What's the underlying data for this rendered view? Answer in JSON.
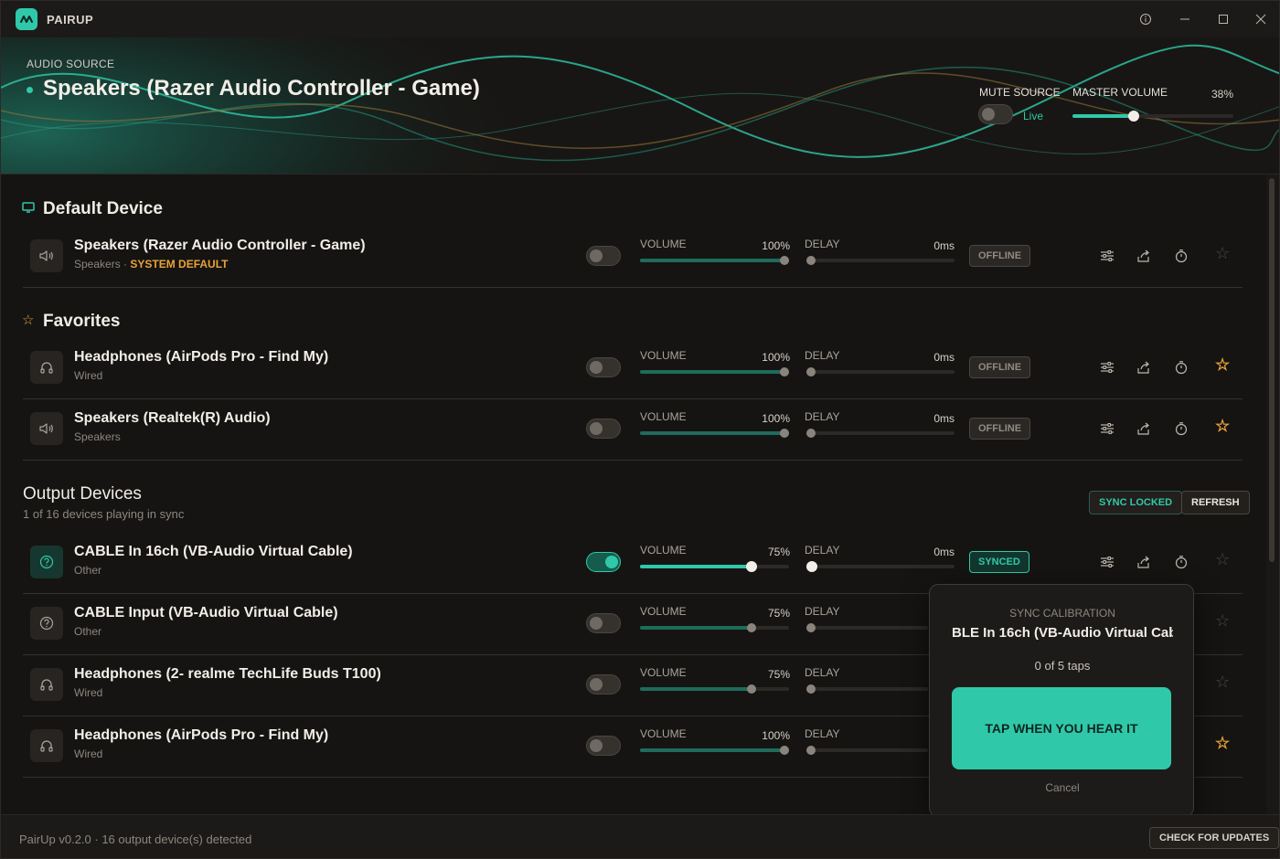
{
  "app": {
    "name": "PAIRUP"
  },
  "window": {
    "info_icon": "info-icon",
    "minimize_icon": "minimize-icon",
    "maximize_icon": "maximize-icon",
    "close_icon": "close-icon"
  },
  "hero": {
    "label": "AUDIO SOURCE",
    "source_name": "Speakers (Razer Audio Controller - Game)",
    "mute_label": "MUTE SOURCE",
    "mute_state": "Live",
    "master_label": "MASTER VOLUME",
    "master_value": "38%",
    "master_level": 0.38
  },
  "sections": {
    "default_title": "Default Device",
    "favorites_title": "Favorites",
    "outputs_title": "Output Devices",
    "outputs_subtitle": "1 of 16 devices playing in sync",
    "sync_locked": "SYNC LOCKED",
    "refresh": "REFRESH"
  },
  "labels": {
    "volume": "VOLUME",
    "delay": "DELAY"
  },
  "rows": [
    {
      "name": "Speakers (Razer Audio Controller - Game)",
      "type": "Speakers",
      "badge": " · ",
      "badge_def": "SYSTEM DEFAULT",
      "icon": "speaker-icon",
      "on": false,
      "volume": "100%",
      "vol_level": 1.0,
      "delay": "0ms",
      "status": "OFFLINE",
      "fav": false
    },
    {
      "name": "Headphones (AirPods Pro - Find My)",
      "type": "Wired",
      "icon": "headphones-icon",
      "on": false,
      "volume": "100%",
      "vol_level": 1.0,
      "delay": "0ms",
      "status": "OFFLINE",
      "fav": true
    },
    {
      "name": "Speakers (Realtek(R) Audio)",
      "type": "Speakers",
      "icon": "speaker-icon",
      "on": false,
      "volume": "100%",
      "vol_level": 1.0,
      "delay": "0ms",
      "status": "OFFLINE",
      "fav": true
    },
    {
      "name": "CABLE In 16ch (VB-Audio Virtual Cable)",
      "type": "Other",
      "icon": "question-icon",
      "on": true,
      "volume": "75%",
      "vol_level": 0.75,
      "delay": "0ms",
      "status": "SYNCED",
      "fav": false
    },
    {
      "name": "CABLE Input (VB-Audio Virtual Cable)",
      "type": "Other",
      "icon": "question-icon",
      "on": false,
      "volume": "75%",
      "vol_level": 0.75,
      "fav": false
    },
    {
      "name": "Headphones (2- realme TechLife Buds T100)",
      "type": "Wired",
      "icon": "headphones-icon",
      "on": false,
      "volume": "75%",
      "vol_level": 0.75,
      "fav": false
    },
    {
      "name": "Headphones (AirPods Pro - Find My)",
      "type": "Wired",
      "icon": "headphones-icon",
      "on": false,
      "volume": "100%",
      "vol_level": 1.0,
      "fav": true
    }
  ],
  "popup": {
    "title": "SYNC CALIBRATION",
    "device": "BLE In 16ch (VB-Audio Virtual Cab",
    "taps": "0 of 5 taps",
    "tap_button": "TAP WHEN YOU HEAR IT",
    "cancel": "Cancel"
  },
  "footer": {
    "status": "PairUp v0.2.0 · 16 output device(s) detected",
    "update_button": "CHECK FOR UPDATES"
  },
  "colors": {
    "accent": "#2fc9a9",
    "favorite": "#e8a33a",
    "background": "#161412"
  }
}
